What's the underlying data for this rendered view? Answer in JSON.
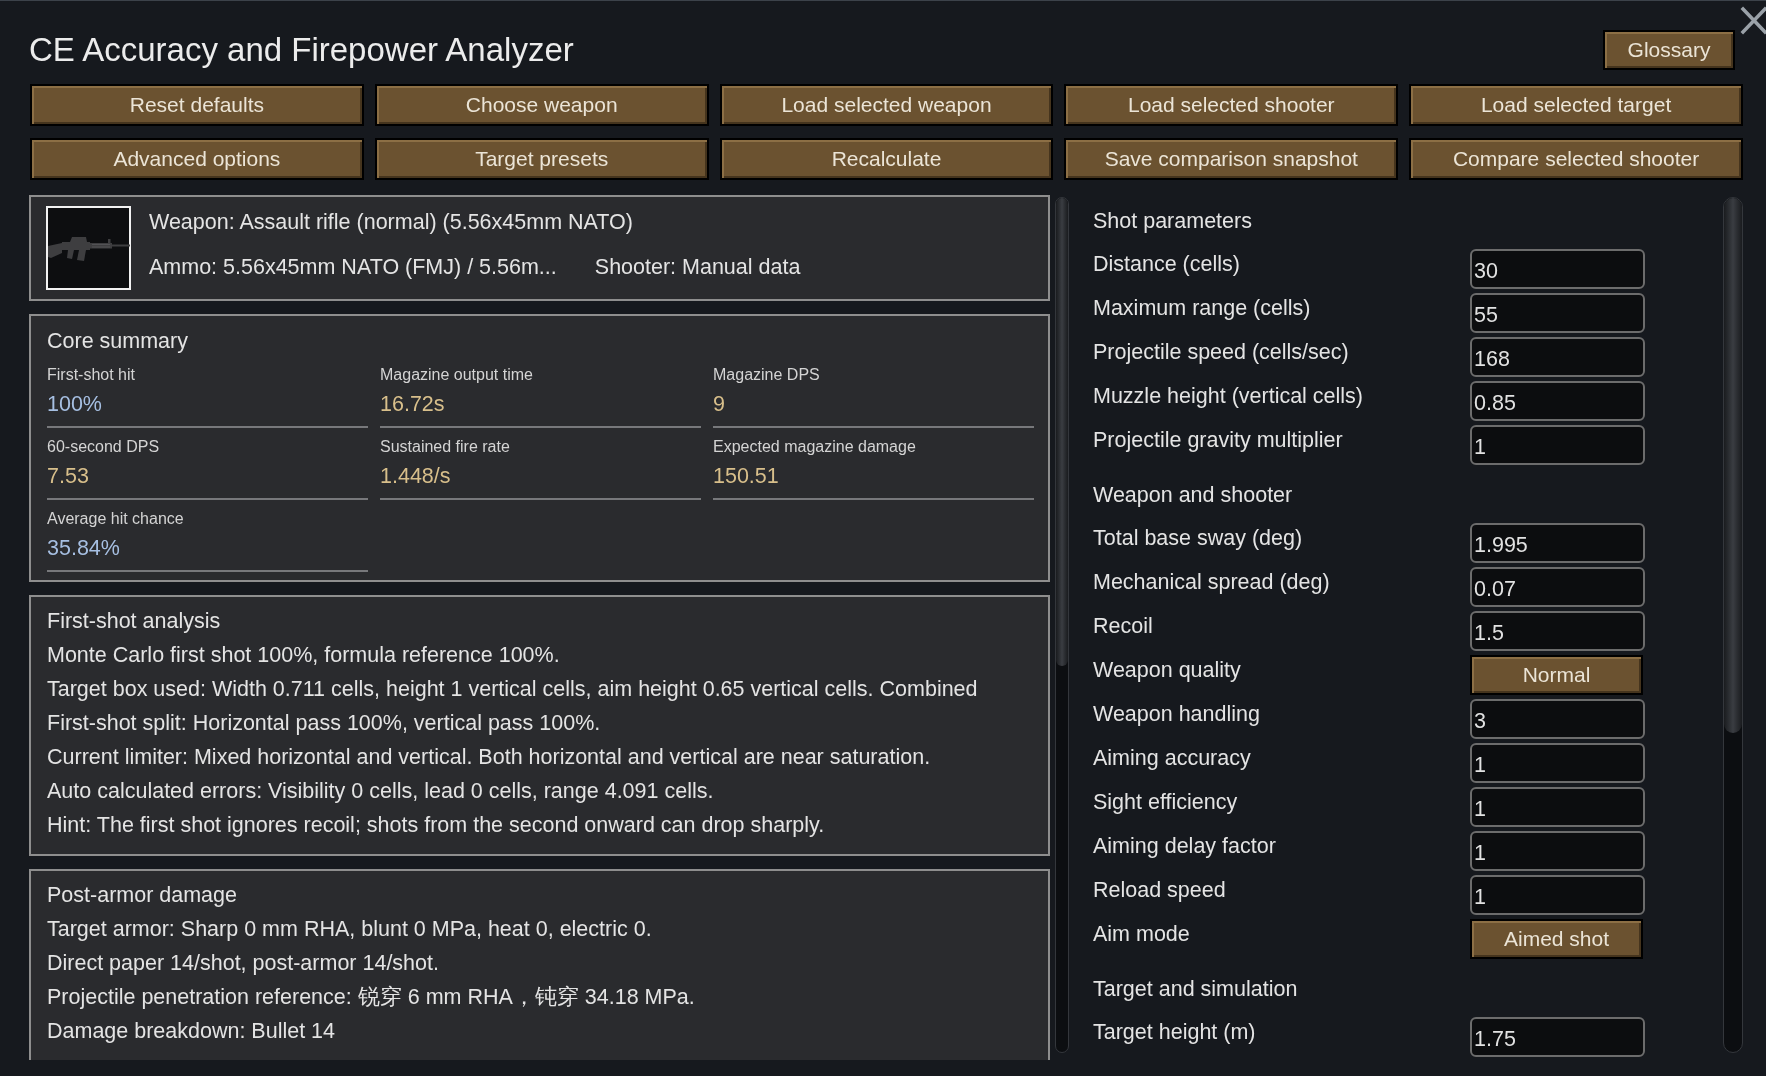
{
  "window": {
    "title": "CE Accuracy and Firepower Analyzer",
    "glossary_button": "Glossary"
  },
  "toolbar": [
    "Reset defaults",
    "Choose weapon",
    "Load selected weapon",
    "Load selected shooter",
    "Load selected target",
    "Advanced options",
    "Target presets",
    "Recalculate",
    "Save comparison snapshot",
    "Compare selected shooter"
  ],
  "weapon_card": {
    "weapon": "Weapon: Assault rifle (normal) (5.56x45mm NATO)",
    "ammo": "Ammo: 5.56x45mm NATO (FMJ) / 5.56m...",
    "shooter": "Shooter: Manual data"
  },
  "sections": [
    {
      "kind": "metrics",
      "title": "Core summary",
      "metrics": [
        {
          "label": "First-shot hit",
          "value": "100%",
          "color": "#a6bfe2"
        },
        {
          "label": "Magazine output time",
          "value": "16.72s",
          "color": "#d8bf8b"
        },
        {
          "label": "Magazine DPS",
          "value": "9",
          "color": "#d8bf8b"
        },
        {
          "label": "60-second DPS",
          "value": "7.53",
          "color": "#d8bf8b"
        },
        {
          "label": "Sustained fire rate",
          "value": "1.448/s",
          "color": "#d8bf8b"
        },
        {
          "label": "Expected magazine damage",
          "value": "150.51",
          "color": "#d8bf8b"
        },
        {
          "label": "Average hit chance",
          "value": "35.84%",
          "color": "#a6bfe2"
        }
      ]
    },
    {
      "kind": "lines",
      "title": "First-shot analysis",
      "lines": [
        "Monte Carlo first shot 100%, formula reference 100%.",
        "Target box used: Width 0.711 cells, height 1 vertical cells, aim height 0.65 vertical cells. Combined",
        "First-shot split: Horizontal pass 100%, vertical pass 100%.",
        "Current limiter: Mixed horizontal and vertical. Both horizontal and vertical are near saturation.",
        "Auto calculated errors: Visibility 0 cells, lead 0 cells, range 4.091 cells.",
        "Hint: The first shot ignores recoil; shots from the second onward can drop sharply."
      ]
    },
    {
      "kind": "lines",
      "title": "Post-armor damage",
      "lines": [
        "Target armor: Sharp 0 mm RHA, blunt 0 MPa, heat 0, electric 0.",
        "Direct paper 14/shot, post-armor 14/shot.",
        "Projectile penetration reference: 锐穿 6 mm RHA，钝穿 34.18 MPa.",
        "Damage breakdown: Bullet 14"
      ]
    }
  ],
  "parameters": [
    {
      "title": "Shot parameters",
      "rows": [
        {
          "label": "Distance (cells)",
          "kind": "input",
          "value": "30"
        },
        {
          "label": "Maximum range (cells)",
          "kind": "input",
          "value": "55"
        },
        {
          "label": "Projectile speed (cells/sec)",
          "kind": "input",
          "value": "168"
        },
        {
          "label": "Muzzle height (vertical cells)",
          "kind": "input",
          "value": "0.85"
        },
        {
          "label": "Projectile gravity multiplier",
          "kind": "input",
          "value": "1"
        }
      ]
    },
    {
      "title": "Weapon and shooter",
      "rows": [
        {
          "label": "Total base sway (deg)",
          "kind": "input",
          "value": "1.995"
        },
        {
          "label": "Mechanical spread (deg)",
          "kind": "input",
          "value": "0.07"
        },
        {
          "label": "Recoil",
          "kind": "input",
          "value": "1.5"
        },
        {
          "label": "Weapon quality",
          "kind": "button",
          "value": "Normal"
        },
        {
          "label": "Weapon handling",
          "kind": "input",
          "value": "3"
        },
        {
          "label": "Aiming accuracy",
          "kind": "input",
          "value": "1"
        },
        {
          "label": "Sight efficiency",
          "kind": "input",
          "value": "1"
        },
        {
          "label": "Aiming delay factor",
          "kind": "input",
          "value": "1"
        },
        {
          "label": "Reload speed",
          "kind": "input",
          "value": "1"
        },
        {
          "label": "Aim mode",
          "kind": "button",
          "value": "Aimed shot"
        }
      ]
    },
    {
      "title": "Target and simulation",
      "rows": [
        {
          "label": "Target height (m)",
          "kind": "input",
          "value": "1.75"
        }
      ]
    }
  ]
}
